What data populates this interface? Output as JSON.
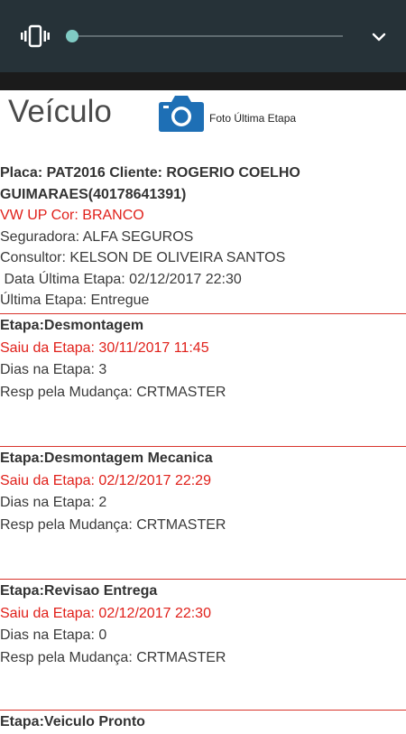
{
  "status_panel": {
    "vibrate_icon": "vibrate-icon",
    "expand_icon": "chevron-down-icon",
    "volume_level": 0
  },
  "header": {
    "title": "Veículo",
    "camera_icon": "camera-icon",
    "camera_label": "Foto Última Etapa"
  },
  "vehicle": {
    "line1": "Placa: PAT2016 Cliente: ROGERIO COELHO",
    "line2": "GUIMARAES(40178641391)",
    "model": "VW UP Cor: BRANCO",
    "insurer": "Seguradora: ALFA SEGUROS",
    "consultant": "Consultor: KELSON DE OLIVEIRA SANTOS",
    "last_stage_date": " Data Última Etapa: 02/12/2017 22:30",
    "last_stage": "Última Etapa: Entregue"
  },
  "stages": [
    {
      "title": "Etapa:Desmontagem",
      "left": "Saiu da Etapa: 30/11/2017 11:45",
      "days": "Dias na Etapa: 3",
      "resp": "Resp pela Mudança: CRTMASTER"
    },
    {
      "title": "Etapa:Desmontagem Mecanica",
      "left": "Saiu da Etapa: 02/12/2017 22:29",
      "days": "Dias na Etapa: 2",
      "resp": "Resp pela Mudança: CRTMASTER"
    },
    {
      "title": "Etapa:Revisao Entrega",
      "left": "Saiu da Etapa: 02/12/2017 22:30",
      "days": "Dias na Etapa: 0",
      "resp": "Resp pela Mudança: CRTMASTER"
    },
    {
      "title": "Etapa:Veiculo Pronto"
    }
  ],
  "colors": {
    "panel": "#263238",
    "accent": "#80cbc4",
    "red": "#e0201a",
    "camera": "#1e6fb5"
  }
}
